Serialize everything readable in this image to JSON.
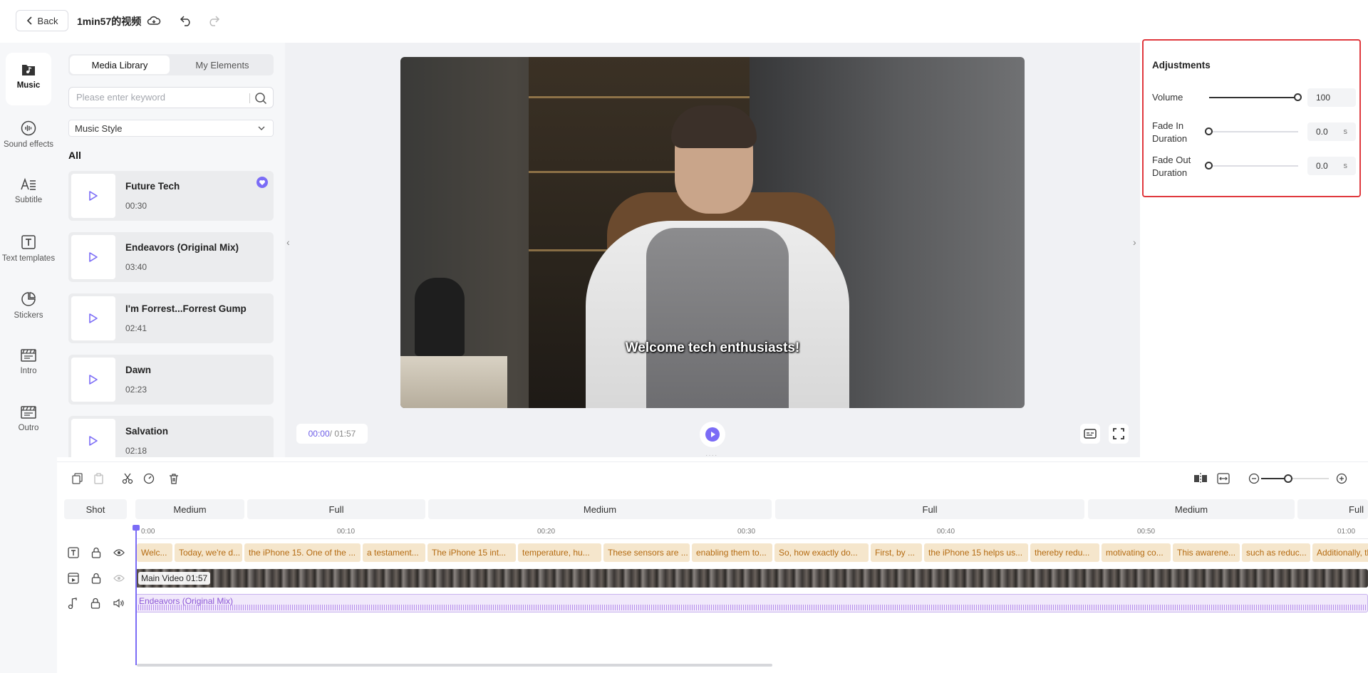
{
  "header": {
    "back_label": "Back",
    "project_title": "1min57的视频"
  },
  "rail": {
    "items": [
      {
        "label": "Music",
        "icon": "music-folder-icon",
        "active": true
      },
      {
        "label": "Sound effects",
        "icon": "sound-wave-icon"
      },
      {
        "label": "Subtitle",
        "icon": "subtitle-icon"
      },
      {
        "label": "Text templates",
        "icon": "text-template-icon"
      },
      {
        "label": "Stickers",
        "icon": "sticker-icon"
      },
      {
        "label": "Intro",
        "icon": "clapper-icon"
      },
      {
        "label": "Outro",
        "icon": "clapper-icon"
      }
    ]
  },
  "media": {
    "tabs": [
      "Media Library",
      "My Elements"
    ],
    "search_placeholder": "Please enter keyword",
    "style_select": "Music Style",
    "section_label": "All",
    "tracks": [
      {
        "name": "Future Tech",
        "duration": "00:30",
        "favorite": true
      },
      {
        "name": "Endeavors (Original Mix)",
        "duration": "03:40"
      },
      {
        "name": "I'm Forrest...Forrest Gump",
        "duration": "02:41"
      },
      {
        "name": "Dawn",
        "duration": "02:23"
      },
      {
        "name": "Salvation",
        "duration": "02:18"
      }
    ]
  },
  "preview": {
    "subtitle": "Welcome tech enthusiasts!",
    "current_time": "00:00",
    "total_time": " / 01:57"
  },
  "adjustments": {
    "title": "Adjustments",
    "volume_label": "Volume",
    "volume_value": "100",
    "volume_level": 1.0,
    "fade_in_label_1": "Fade In",
    "fade_in_label_2": "Duration",
    "fade_in_value": "0.0",
    "fade_in_level": 0.0,
    "fade_out_label_1": "Fade Out",
    "fade_out_label_2": "Duration",
    "fade_out_value": "0.0",
    "fade_out_level": 0.0,
    "unit": "s"
  },
  "timeline": {
    "shot_label": "Shot",
    "shots": [
      "Medium",
      "Full",
      "Medium",
      "Full",
      "Medium",
      "Full"
    ],
    "ruler": [
      "0:00",
      "00:10",
      "00:20",
      "00:30",
      "00:40",
      "00:50",
      "01:00"
    ],
    "subtitles": [
      "Welc...",
      "Today, we're d...",
      "the iPhone 15. One of the ...",
      "a testament...",
      "The iPhone 15 int...",
      "temperature, hu...",
      "These sensors are ...",
      "enabling them to...",
      "So, how exactly do...",
      "First, by ...",
      "the iPhone 15 helps us...",
      "thereby redu...",
      "motivating co...",
      "This awarene...",
      "such as reduc...",
      "Additionally, the iP"
    ],
    "video_label": "Main Video 01:57",
    "audio_label": "Endeavors (Original Mix)"
  },
  "colors": {
    "accent": "#7b6cf6",
    "highlight_border": "#e0393e",
    "subtitle_clip": "#f5e6cc",
    "audio_clip": "#f1e9fb"
  }
}
